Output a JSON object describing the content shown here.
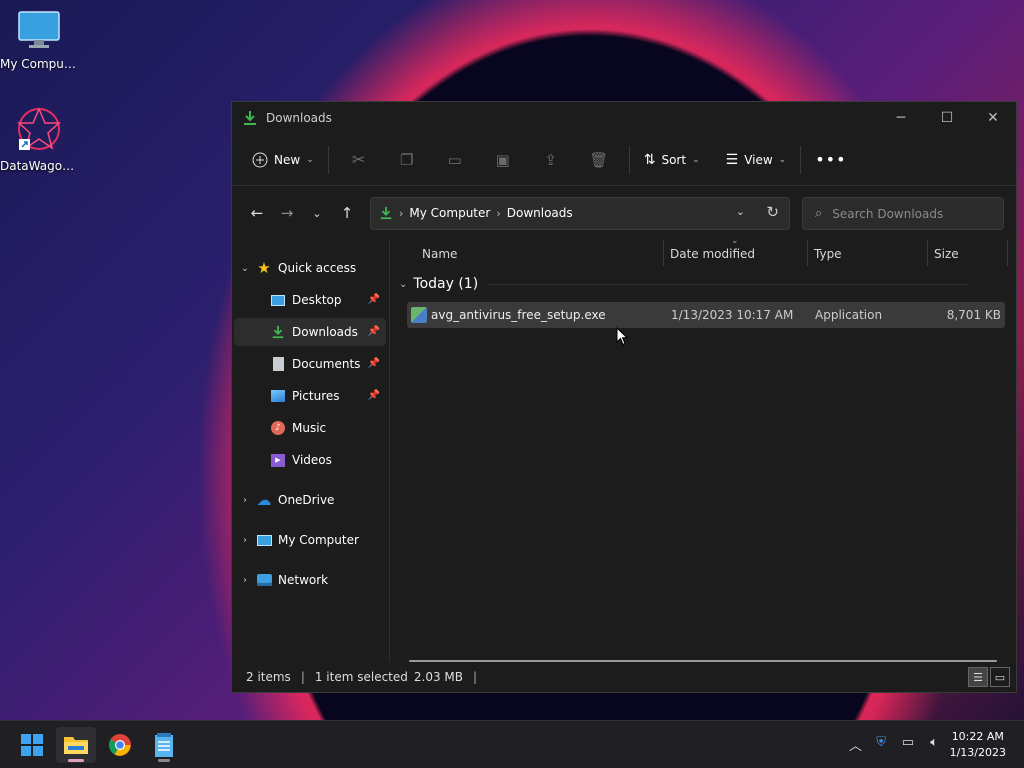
{
  "desktop": {
    "icons": [
      {
        "label": "My Computer"
      },
      {
        "label": "DataWagon..."
      }
    ]
  },
  "window": {
    "title": "Downloads",
    "toolbar": {
      "new_label": "New",
      "sort_label": "Sort",
      "view_label": "View"
    },
    "address": {
      "crumbs": [
        "My Computer",
        "Downloads"
      ]
    },
    "search": {
      "placeholder": "Search Downloads"
    },
    "sidebar": {
      "quick_access": "Quick access",
      "items": [
        {
          "label": "Desktop",
          "pinned": true
        },
        {
          "label": "Downloads",
          "pinned": true,
          "selected": true
        },
        {
          "label": "Documents",
          "pinned": true
        },
        {
          "label": "Pictures",
          "pinned": true
        },
        {
          "label": "Music"
        },
        {
          "label": "Videos"
        }
      ],
      "roots": [
        {
          "label": "OneDrive"
        },
        {
          "label": "My Computer"
        },
        {
          "label": "Network"
        }
      ]
    },
    "columns": {
      "name": "Name",
      "date": "Date modified",
      "type": "Type",
      "size": "Size"
    },
    "group": "Today (1)",
    "files": [
      {
        "name": "avg_antivirus_free_setup.exe",
        "date": "1/13/2023 10:17 AM",
        "type": "Application",
        "size": "8,701 KB"
      }
    ],
    "status": {
      "items": "2 items",
      "selected": "1 item selected",
      "selected_size": "2.03 MB"
    }
  },
  "taskbar": {
    "clock_time": "10:22 AM",
    "clock_date": "1/13/2023"
  },
  "colors": {
    "accent": "#0078d4",
    "download_green": "#3fb950"
  }
}
